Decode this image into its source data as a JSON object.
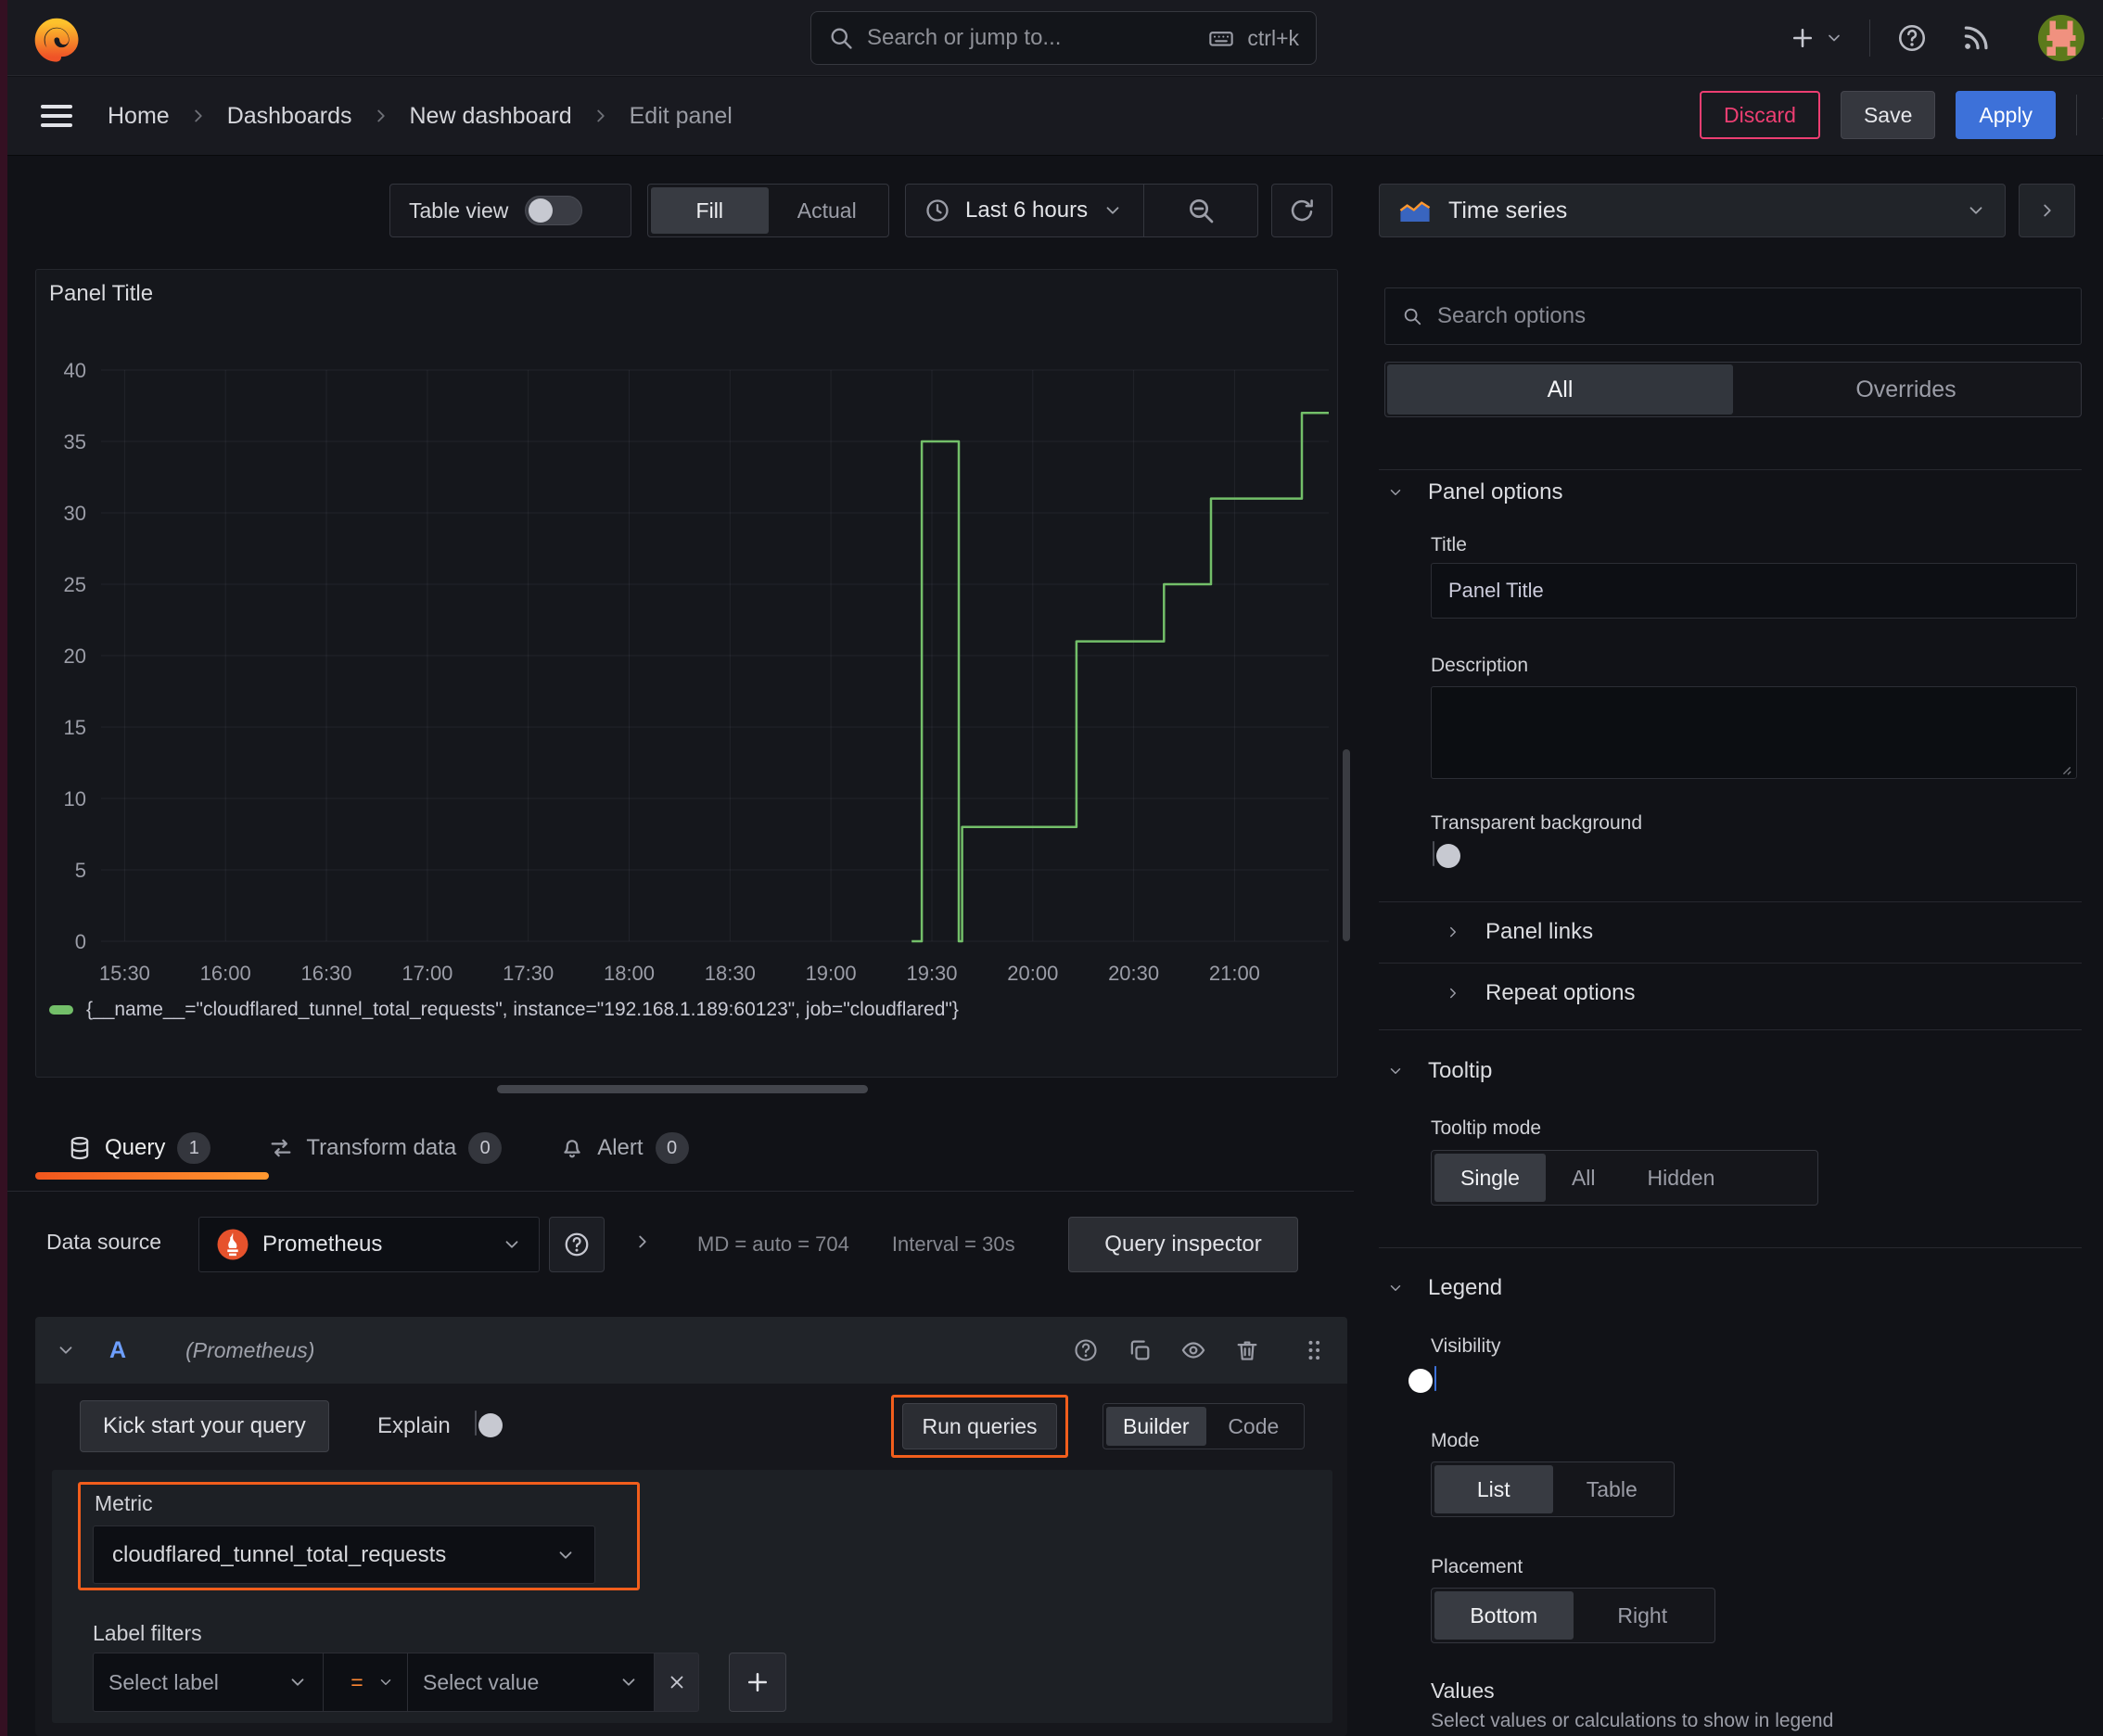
{
  "topnav": {
    "search_placeholder": "Search or jump to...",
    "shortcut_label": "ctrl+k"
  },
  "breadcrumb": {
    "items": [
      "Home",
      "Dashboards",
      "New dashboard",
      "Edit panel"
    ]
  },
  "actions": {
    "discard": "Discard",
    "save": "Save",
    "apply": "Apply"
  },
  "toolbar": {
    "table_view_label": "Table view",
    "fill_label": "Fill",
    "actual_label": "Actual",
    "time_range_label": "Last 6 hours"
  },
  "panel": {
    "title": "Panel Title",
    "legend_series": "{__name__=\"cloudflared_tunnel_total_requests\", instance=\"192.168.1.189:60123\", job=\"cloudflared\"}"
  },
  "chart_data": {
    "type": "line",
    "title": "Panel Title",
    "step_mode": "after",
    "grid": true,
    "legend_position": "bottom",
    "line_color": "#73bf69",
    "x_range": [
      "15:23",
      "21:28"
    ],
    "x_ticks": [
      "15:30",
      "16:00",
      "16:30",
      "17:00",
      "17:30",
      "18:00",
      "18:30",
      "19:00",
      "19:30",
      "20:00",
      "20:30",
      "21:00"
    ],
    "y_ticks": [
      0,
      5,
      10,
      15,
      20,
      25,
      30,
      35,
      40
    ],
    "ylim": [
      0,
      40
    ],
    "series": [
      {
        "name": "{__name__=\"cloudflared_tunnel_total_requests\", instance=\"192.168.1.189:60123\", job=\"cloudflared\"}",
        "points": [
          [
            "19:24",
            0
          ],
          [
            "19:27",
            35
          ],
          [
            "19:38",
            0
          ],
          [
            "19:39",
            8
          ],
          [
            "20:13",
            21
          ],
          [
            "20:39",
            25
          ],
          [
            "20:53",
            31
          ],
          [
            "21:20",
            37
          ]
        ]
      }
    ]
  },
  "tabs": {
    "query_label": "Query",
    "query_count": "1",
    "transform_label": "Transform data",
    "transform_count": "0",
    "alert_label": "Alert",
    "alert_count": "0"
  },
  "datasource": {
    "label": "Data source",
    "name": "Prometheus",
    "stats_md": "MD = auto = 704",
    "stats_interval": "Interval = 30s",
    "query_inspector_label": "Query inspector"
  },
  "query": {
    "ref_id": "A",
    "ds_hint": "(Prometheus)",
    "kick_start_label": "Kick start your query",
    "explain_label": "Explain",
    "run_queries_label": "Run queries",
    "builder_label": "Builder",
    "code_label": "Code",
    "metric_label": "Metric",
    "metric_value": "cloudflared_tunnel_total_requests",
    "label_filters_label": "Label filters",
    "select_label_placeholder": "Select label",
    "operator_value": "=",
    "select_value_placeholder": "Select value"
  },
  "options": {
    "viz_type": "Time series",
    "search_placeholder": "Search options",
    "tab_all": "All",
    "tab_overrides": "Overrides",
    "panel_options": {
      "header": "Panel options",
      "title_label": "Title",
      "title_value": "Panel Title",
      "description_label": "Description",
      "transparent_label": "Transparent background"
    },
    "panel_links_header": "Panel links",
    "repeat_options_header": "Repeat options",
    "tooltip": {
      "header": "Tooltip",
      "mode_label": "Tooltip mode",
      "single": "Single",
      "all": "All",
      "hidden": "Hidden"
    },
    "legend": {
      "header": "Legend",
      "visibility_label": "Visibility",
      "mode_label": "Mode",
      "list": "List",
      "table": "Table",
      "placement_label": "Placement",
      "bottom": "Bottom",
      "right": "Right",
      "values_label": "Values",
      "values_hint": "Select values or calculations to show in legend"
    }
  },
  "colors": {
    "accent_orange": "#f25e1c",
    "primary_blue": "#3d71d9",
    "danger_pink": "#ed3e72",
    "series_green": "#73bf69",
    "refid_blue": "#6e9fff",
    "equals_orange": "#ff8833",
    "underline_from": "#f2561d",
    "underline_to": "#ff9830"
  }
}
